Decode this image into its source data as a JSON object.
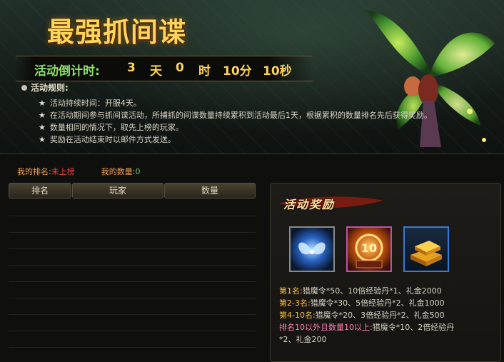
{
  "banner": {
    "title": "最强抓间谍",
    "countdown": {
      "label": "活动倒计时:",
      "days": "3",
      "days_unit": "天",
      "hours": "0",
      "hours_unit": "时",
      "minutes": "10分",
      "seconds": "10秒"
    },
    "rules_title": "活动规则:",
    "rules": [
      "活动持续时间：开服4天。",
      "在活动期间参与抓间谍活动，所捕抓的间谍数量持续累积到活动最后1天，根据累积的数量排名先后获得奖励。",
      "数量相同的情况下，取先上榜的玩家。",
      "奖励在活动结束时以邮件方式发送。"
    ]
  },
  "rank": {
    "my_rank_label": "我的排名:",
    "my_rank_value": "未上榜",
    "my_count_label": "我的数量:",
    "my_count_value": "0"
  },
  "table": {
    "headers": [
      "排名",
      "玩家",
      "数量"
    ]
  },
  "rewards": {
    "title": "活动奖励",
    "items": [
      {
        "name": "猎魔令",
        "icon": "blue-butterfly-orb-icon"
      },
      {
        "name": "10倍经验丹",
        "icon": "experience-potion-10x-icon"
      },
      {
        "name": "礼金",
        "icon": "gold-bars-icon"
      }
    ],
    "tiers": [
      {
        "rank": "第1名:",
        "desc": "猎魔令*50、10倍经验丹*1、礼金2000"
      },
      {
        "rank": "第2-3名:",
        "desc": "猎魔令*30、5倍经验丹*2、礼金1000"
      },
      {
        "rank": "第4-10名:",
        "desc": "猎魔令*20、3倍经验丹*2、礼金500"
      },
      {
        "rank": "排名10以外且数量10以上:",
        "desc": "猎魔令*10、2倍经验丹",
        "desc2": "*2、礼金200"
      }
    ]
  },
  "colors": {
    "accent_gold": "#ffd25c",
    "label_green": "#8fe06a",
    "rank_red": "#ff4040",
    "tier_pink": "#ff80b0"
  }
}
